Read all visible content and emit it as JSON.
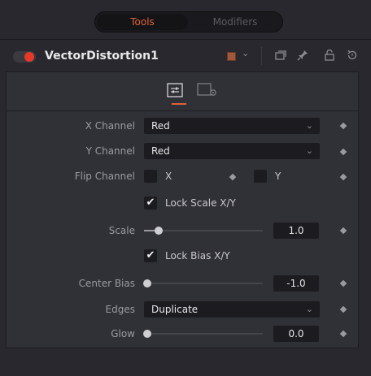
{
  "top_tabs": {
    "tools": "Tools",
    "modifiers": "Modifiers",
    "active_color": "#e0623a"
  },
  "header": {
    "tool_name": "VectorDistortion1",
    "toggle_enabled": true,
    "color_swatch": "#a0583a",
    "icons": [
      "chevron-down-icon",
      "window-icon",
      "pin-icon",
      "lock-icon",
      "reset-icon"
    ]
  },
  "panel_tabs": {
    "active": "controls-icon",
    "inactive": "settings-icon"
  },
  "controls": {
    "x_channel": {
      "label": "X Channel",
      "value": "Red"
    },
    "y_channel": {
      "label": "Y Channel",
      "value": "Red"
    },
    "flip_channel": {
      "label": "Flip Channel",
      "x_label": "X",
      "y_label": "Y",
      "x_checked": false,
      "y_checked": false
    },
    "lock_scale": {
      "label": "Lock Scale X/Y",
      "checked": true
    },
    "scale": {
      "label": "Scale",
      "value": "1.0",
      "slider_fraction": 0.1
    },
    "lock_bias": {
      "label": "Lock Bias X/Y",
      "checked": true
    },
    "center_bias": {
      "label": "Center Bias",
      "value": "-1.0",
      "slider_fraction": 0.0
    },
    "edges": {
      "label": "Edges",
      "value": "Duplicate"
    },
    "glow": {
      "label": "Glow",
      "value": "0.0",
      "slider_fraction": 0.0
    }
  }
}
